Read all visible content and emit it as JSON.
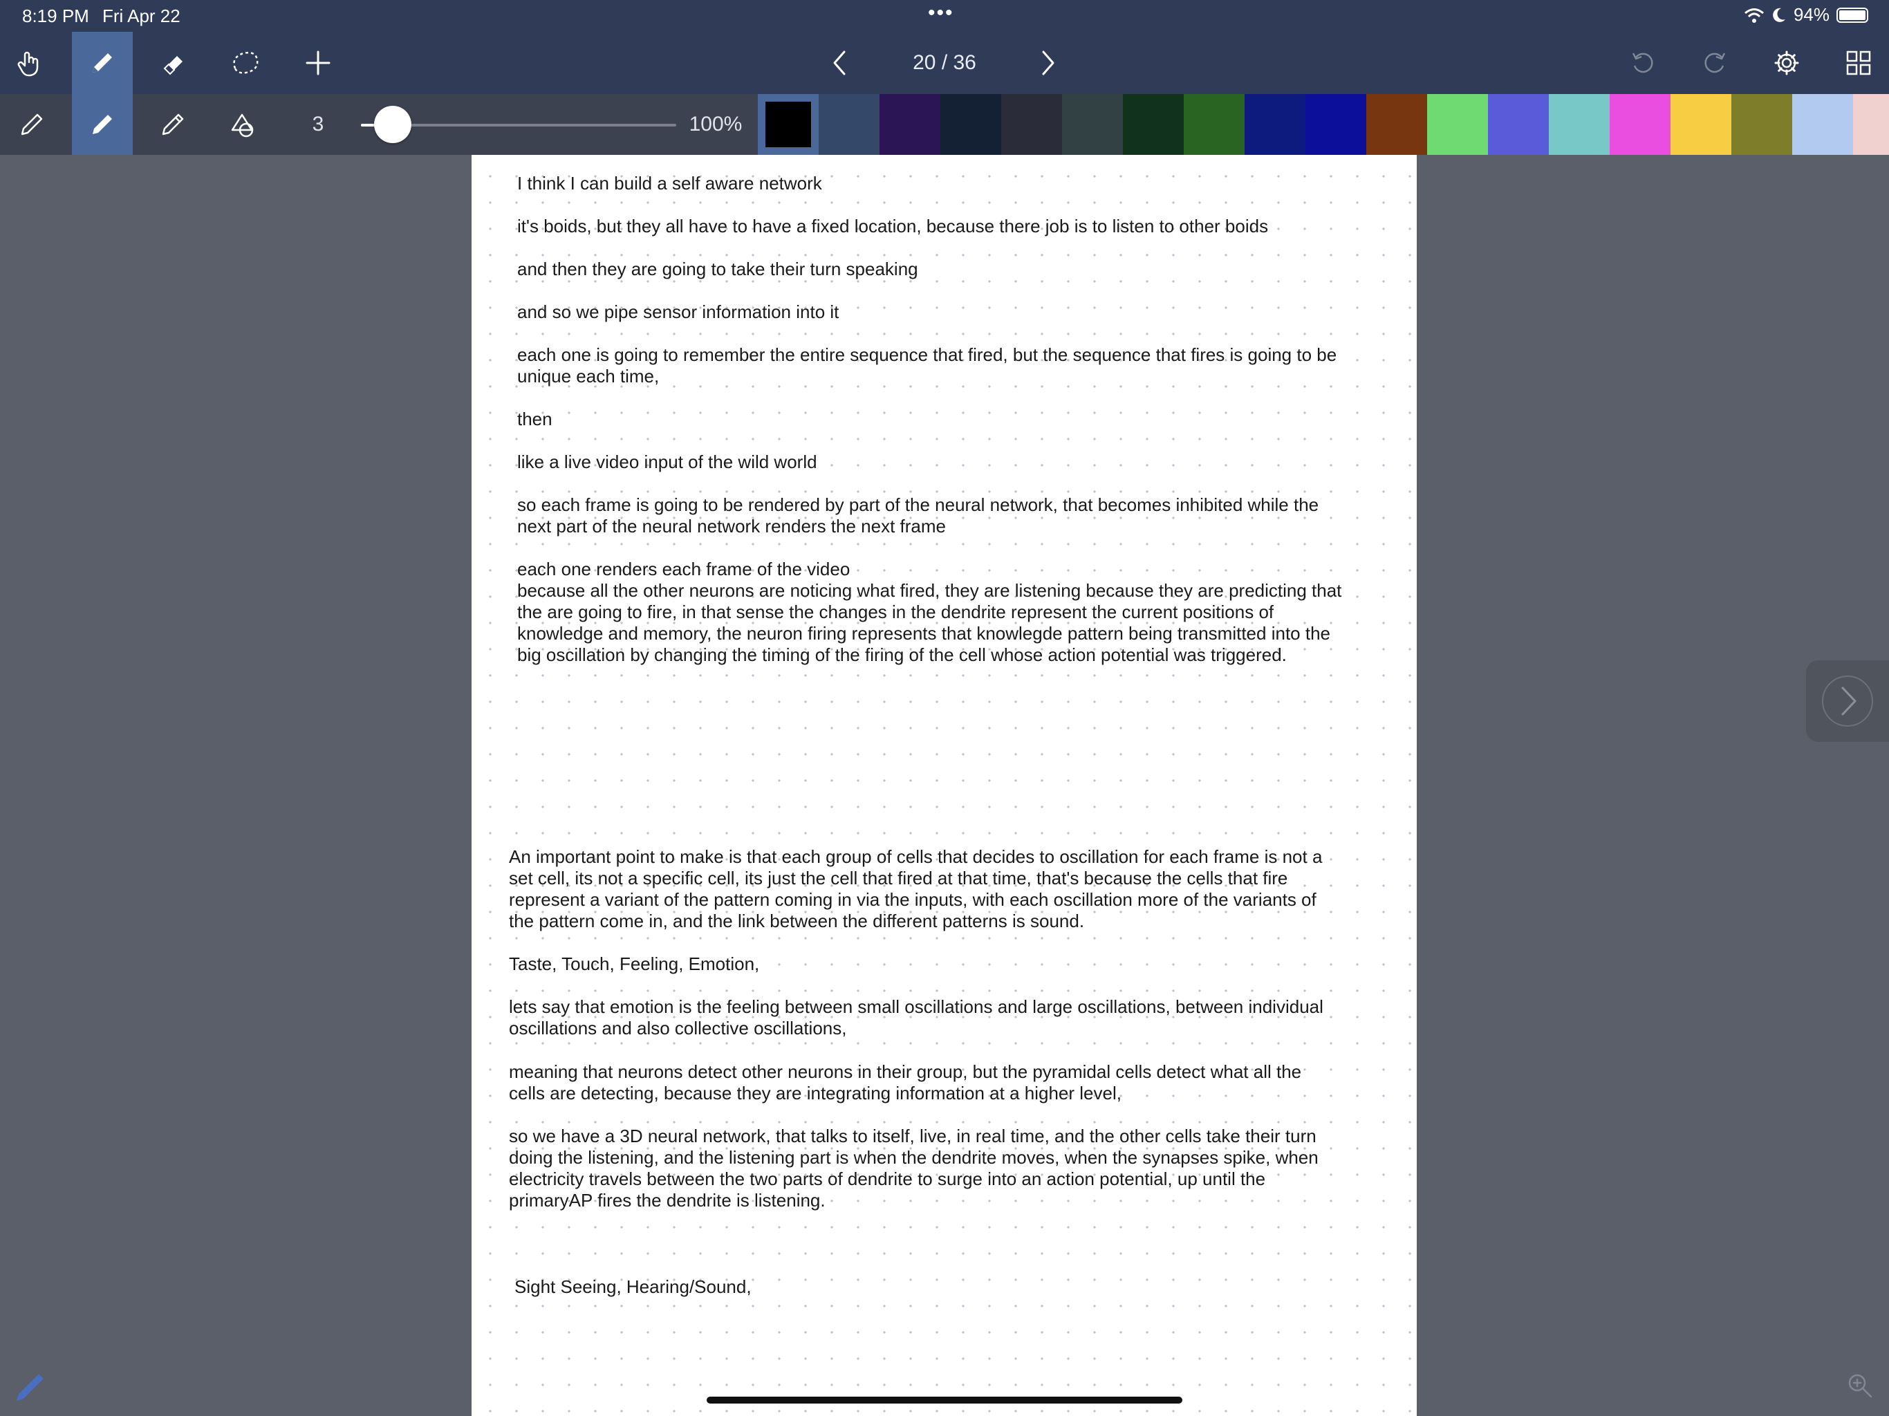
{
  "status_bar": {
    "time": "8:19 PM",
    "date": "Fri Apr 22",
    "battery": "94%",
    "dots": "•••"
  },
  "toolbar": {
    "tools": [
      "hand-icon",
      "pen-icon",
      "eraser-icon",
      "lasso-icon",
      "plus-icon"
    ],
    "active_tool": "pen-icon",
    "page_indicator": "20 / 36",
    "right_tools": [
      "undo-icon",
      "redo-icon",
      "gear-icon",
      "grid-icon"
    ]
  },
  "pen_toolbar": {
    "pens": [
      "fine-pen-icon",
      "marker-pen-icon",
      "pencil-icon",
      "shapes-icon"
    ],
    "active_pen": "marker-pen-icon",
    "thickness": "3",
    "thickness_level": 0.1,
    "zoom": "100%",
    "selected_color": "#000000",
    "colors": [
      "#000000",
      "#34496a",
      "#2b1554",
      "#142033",
      "#2a2c3a",
      "#324244",
      "#11321d",
      "#2a6423",
      "#0d1b7e",
      "#0b0f9a",
      "#773510",
      "#6fda72",
      "#5a5bd8",
      "#78c8c8",
      "#e94ee0",
      "#f7cd44",
      "#7e7d29",
      "#b3caf0",
      "#f1d1d0"
    ]
  },
  "notes": {
    "p1": "I think I can build a self aware network",
    "p2": "it's boids, but they all have to have a fixed location, because there job is to listen to other boids",
    "p3": "and then they are going to take their turn speaking",
    "p4": "and so we pipe sensor information into it",
    "p5": "each one is going to remember the entire sequence that fired, but the sequence that fires is going to be\nunique each time,",
    "p6": "then",
    "p7": "like a live video input of the wild world",
    "p8": "so each frame is going to be rendered by part of the neural network, that becomes inhibited while the\nnext part of the neural network renders the next frame",
    "p9": "each one renders each frame of the video\nbecause all the other neurons are noticing what fired, they are listening because they are predicting that\nthe are going to fire, in that sense the changes in the dendrite represent the current positions of\nknowledge and memory, the neuron firing represents that knowlegde pattern being transmitted into the\nbig oscillation by changing the timing of the firing of the cell whose action potential was triggered.",
    "p10": "An important point to make is that each group of cells that decides to oscillation for each frame is not a\nset cell, its not a specific cell, its just the cell that fired at that time, that's because the cells that fire\nrepresent a variant of the pattern coming in via the inputs, with each oscillation more of the variants of\nthe pattern come in, and the link between the different patterns is sound.",
    "p11": "Taste, Touch, Feeling, Emotion,",
    "p12": "lets say that emotion is the feeling between small oscillations and large oscillations, between individual\noscillations and also collective oscillations,",
    "p13": "meaning that neurons detect other neurons in their group, but the pyramidal cells detect what all the\ncells are detecting, because they are integrating information at a higher level,",
    "p14": "so we have a 3D neural network, that talks to itself, live, in real time, and the other cells take their turn\ndoing the listening, and the listening part is when the dendrite moves, when the synapses spike, when\nelectricity travels between the two parts of dendrite to surge into an action potential, up until the\nprimaryAP fires the dendrite is listening.",
    "p15": "Sight Seeing, Hearing/Sound,"
  }
}
